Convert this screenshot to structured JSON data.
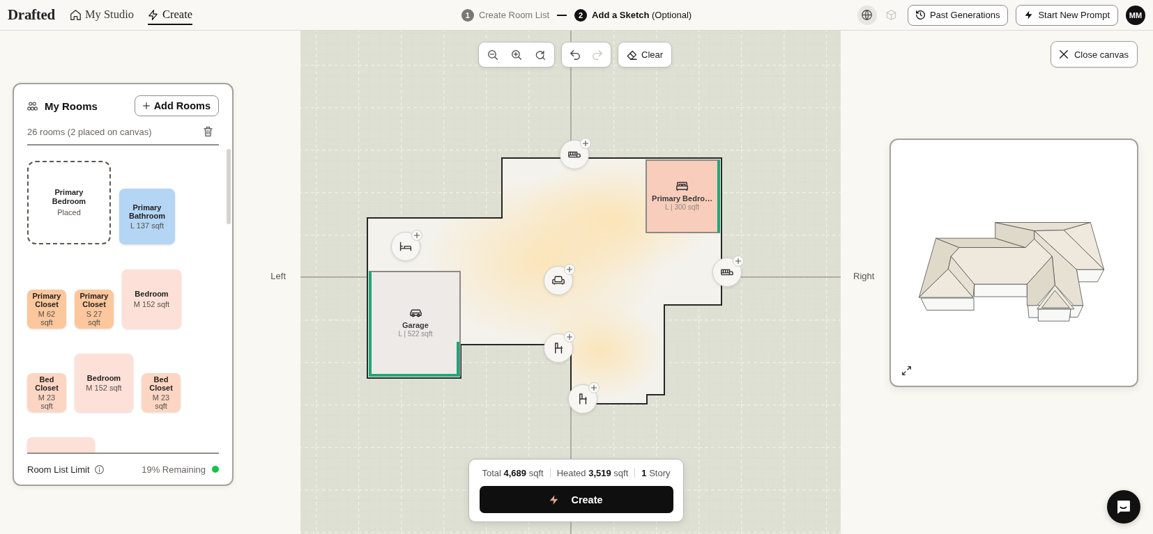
{
  "header": {
    "logo": "Drafted",
    "nav": [
      {
        "label": "My Studio",
        "selected": false
      },
      {
        "label": "Create",
        "selected": true
      }
    ],
    "steps": [
      {
        "number": "1",
        "label": "Create Room List",
        "selected": false
      },
      {
        "number": "2",
        "label": "**Add a Sketch** (Optional)",
        "selected": true
      }
    ],
    "view_modes": [
      {
        "selected": true
      },
      {
        "selected": false
      }
    ],
    "past_generations_button": "Past Generations",
    "new_prompt_button": "Start New Prompt",
    "avatar": "MM"
  },
  "rooms_panel": {
    "title": "My Rooms",
    "add_button": "Add Rooms",
    "count": "26 rooms (2 placed on canvas)",
    "rooms": [
      {
        "kind": "placed",
        "name": "Primary Bedroom",
        "status": "Placed"
      },
      {
        "kind": "tile",
        "name": "Primary Bathroom",
        "size": "L 137 sqft",
        "color": "#b4d5f3"
      },
      {
        "kind": "tile",
        "name": "Primary Closet",
        "size": "M 62 sqft",
        "color": "#fcc79c"
      },
      {
        "kind": "tile",
        "name": "Primary Closet",
        "size": "S 27 sqft",
        "color": "#fcc79c"
      },
      {
        "kind": "tile",
        "name": "Bedroom",
        "size": "M 152 sqft",
        "color": "#fde0d7"
      },
      {
        "kind": "tile",
        "name": "Bed Closet",
        "size": "M 23 sqft",
        "color": "#fcd6c3"
      },
      {
        "kind": "tile",
        "name": "Bedroom",
        "size": "M 152 sqft",
        "color": "#fde0d7"
      },
      {
        "kind": "tile",
        "name": "Bed Closet",
        "size": "M 23 sqft",
        "color": "#fcd6c3"
      },
      {
        "kind": "tile",
        "color": "#fde0d7"
      }
    ],
    "limit_label": "Room List Limit",
    "remaining": "19% Remaining"
  },
  "canvas": {
    "left_label": "Left",
    "right_label": "Right",
    "history": [
      {
        "disabled": false
      },
      {
        "disabled": true
      }
    ],
    "clear_button": "Clear",
    "rooms": [
      {
        "name": "Primary Bedro…",
        "size": "L | 300 sqft",
        "color": "#f9cdbb"
      },
      {
        "name": "Garage",
        "size": "L | 522 sqft",
        "color": "#eeeae8"
      }
    ],
    "summary": [
      "Total **4,689** sqft",
      "Heated **3,519** sqft",
      "**1** Story"
    ],
    "create_button": "Create"
  },
  "close_button": "Close canvas"
}
